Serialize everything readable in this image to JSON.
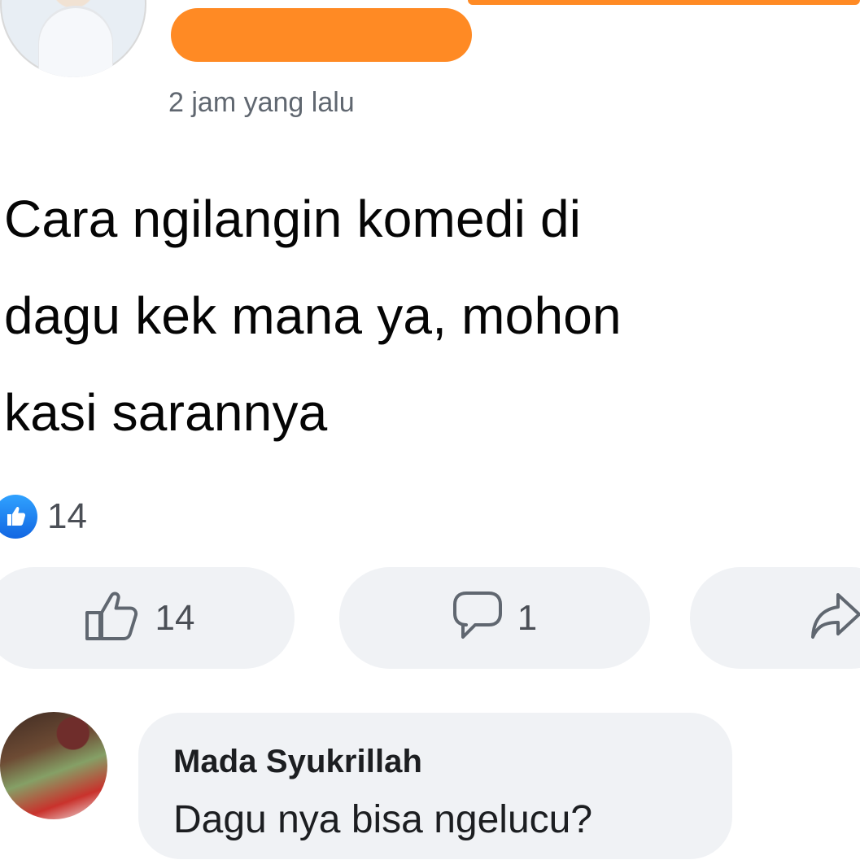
{
  "post": {
    "timestamp": "2 jam yang lalu",
    "text": "Cara ngilangin komedi di\ndagu kek mana ya, mohon\nkasi sarannya",
    "reactions_count": "14"
  },
  "actions": {
    "like_count": "14",
    "comment_count": "1"
  },
  "comment": {
    "author": "Mada Syukrillah",
    "text": "Dagu nya bisa ngelucu?"
  },
  "colors": {
    "like_blue": "#1877f2",
    "redaction_orange": "#ff8a24",
    "pill_bg": "#f0f2f5",
    "secondary_text": "#606770"
  },
  "icons": {
    "reaction": "like-thumb-icon",
    "like_action": "thumbs-up-outline-icon",
    "comment_action": "speech-bubble-icon",
    "share_action": "share-arrow-icon"
  }
}
